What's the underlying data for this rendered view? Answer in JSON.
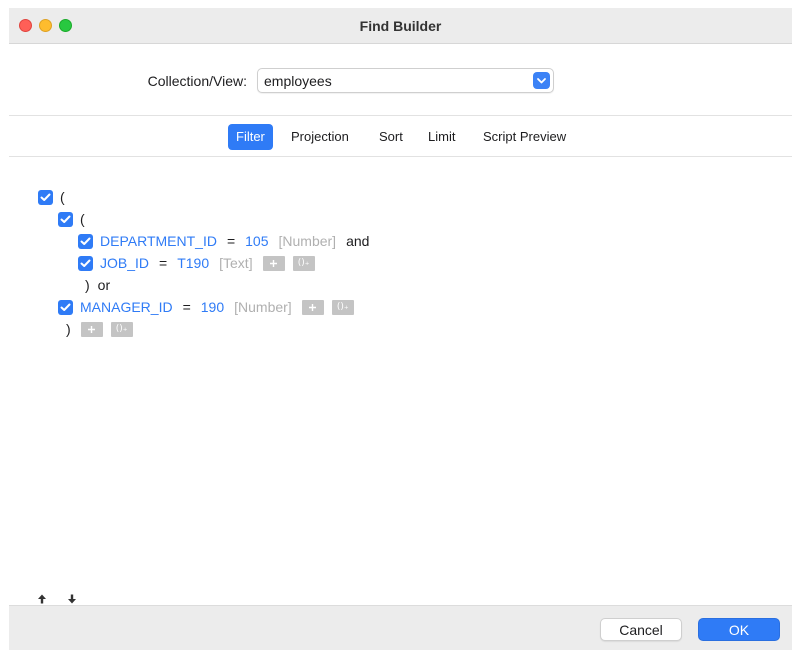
{
  "window": {
    "title": "Find Builder"
  },
  "collection": {
    "label": "Collection/View:",
    "value": "employees"
  },
  "tabs": [
    {
      "label": "Filter",
      "active": true
    },
    {
      "label": "Projection",
      "active": false
    },
    {
      "label": "Sort",
      "active": false
    },
    {
      "label": "Limit",
      "active": false
    },
    {
      "label": "Script Preview",
      "active": false
    }
  ],
  "filter": {
    "outer_open": "(",
    "inner_open": "(",
    "condition_1": {
      "field": "DEPARTMENT_ID",
      "operator": "=",
      "value": "105",
      "type": "[Number]",
      "conjunction": "and",
      "checked": true
    },
    "condition_2": {
      "field": "JOB_ID",
      "operator": "=",
      "value": "T190",
      "type": "[Text]",
      "checked": true
    },
    "inner_close": ")",
    "inner_conjunction": "or",
    "condition_3": {
      "field": "MANAGER_ID",
      "operator": "=",
      "value": "190",
      "type": "[Number]",
      "checked": true
    },
    "outer_close": ")",
    "add_group_glyph": "()₊"
  },
  "footer": {
    "cancel_label": "Cancel",
    "ok_label": "OK"
  },
  "colors": {
    "accent": "#2f7bf6",
    "type_hint": "#b0b0b0",
    "mini_button": "#c4c4c4"
  },
  "icons": [
    "close-icon",
    "minimize-icon",
    "zoom-icon",
    "chevron-down-icon",
    "checkmark-icon",
    "plus-icon",
    "add-group-icon",
    "arrow-up-icon",
    "arrow-down-icon"
  ]
}
